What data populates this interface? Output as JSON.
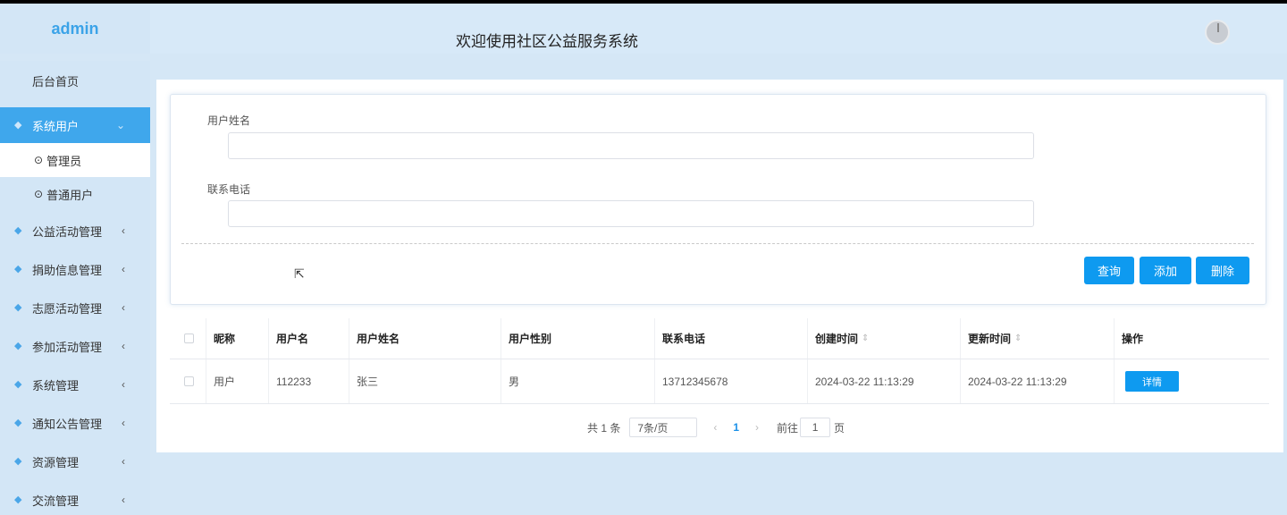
{
  "header": {
    "brand": "admin",
    "title": "欢迎使用社区公益服务系统"
  },
  "sidebar": {
    "home": "后台首页",
    "items": [
      {
        "label": "系统用户",
        "arrow": "⌄"
      },
      {
        "label": "公益活动管理",
        "arrow": "‹"
      },
      {
        "label": "捐助信息管理",
        "arrow": "‹"
      },
      {
        "label": "志愿活动管理",
        "arrow": "‹"
      },
      {
        "label": "参加活动管理",
        "arrow": "‹"
      },
      {
        "label": "系统管理",
        "arrow": "‹"
      },
      {
        "label": "通知公告管理",
        "arrow": "‹"
      },
      {
        "label": "资源管理",
        "arrow": "‹"
      },
      {
        "label": "交流管理",
        "arrow": "‹"
      }
    ],
    "sub_items": [
      {
        "label": "管理员"
      },
      {
        "label": "普通用户"
      }
    ]
  },
  "search": {
    "name_label": "用户姓名",
    "name_value": "",
    "phone_label": "联系电话",
    "phone_value": "",
    "query_label": "查询",
    "add_label": "添加",
    "delete_label": "删除"
  },
  "table": {
    "columns": [
      "昵称",
      "用户名",
      "用户姓名",
      "用户性别",
      "联系电话",
      "创建时间",
      "更新时间",
      "操作"
    ],
    "rows": [
      {
        "nickname": "用户",
        "username": "112233",
        "realname": "张三",
        "gender": "男",
        "phone": "13712345678",
        "created": "2024-03-22 11:13:29",
        "updated": "2024-03-22 11:13:29",
        "action": "详情"
      }
    ]
  },
  "pagination": {
    "total": "共 1 条",
    "page_size": "7条/页",
    "current": "1",
    "goto_label": "前往",
    "goto_value": "1",
    "page_unit": "页"
  },
  "colors": {
    "accent": "#0e9af0",
    "sidebar_bg": "#d3e6f6",
    "active_menu": "#3fa7ec"
  }
}
